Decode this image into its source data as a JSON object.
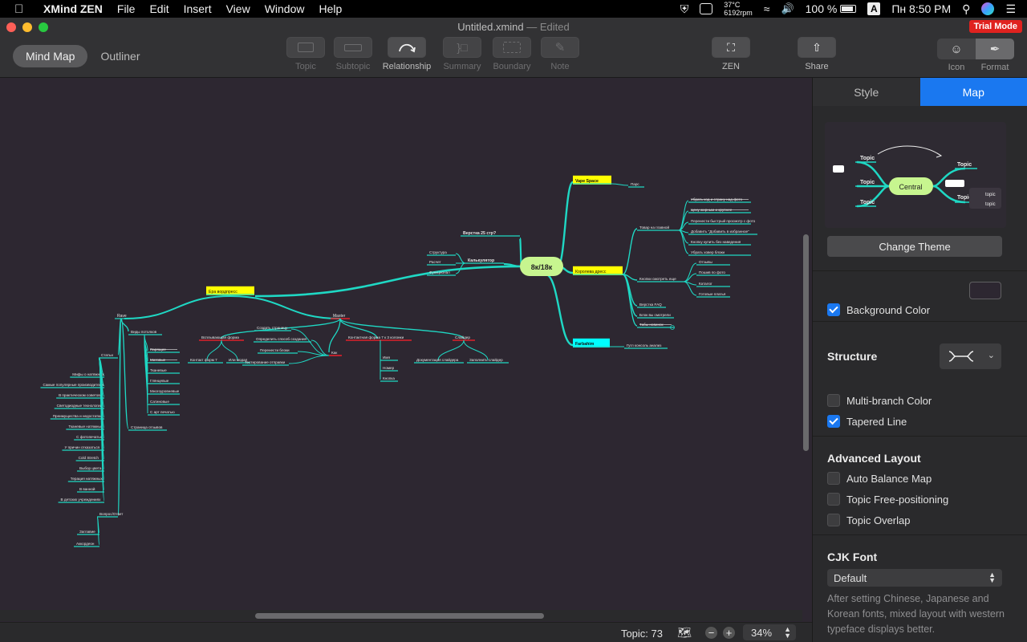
{
  "menubar": {
    "app_name": "XMind ZEN",
    "menus": [
      "File",
      "Edit",
      "Insert",
      "View",
      "Window",
      "Help"
    ],
    "temperature": "37°C",
    "fan": "6192rpm",
    "battery": "100 %",
    "input_source": "A",
    "clock": "Пн 8:50 PM"
  },
  "window": {
    "title": "Untitled.xmind",
    "edited": "— Edited",
    "trial": "Trial Mode",
    "view_tabs": [
      {
        "label": "Mind Map",
        "active": true
      },
      {
        "label": "Outliner",
        "active": false
      }
    ],
    "toolbar": [
      {
        "label": "Topic",
        "enabled": false
      },
      {
        "label": "Subtopic",
        "enabled": false
      },
      {
        "label": "Relationship",
        "enabled": true
      },
      {
        "label": "Summary",
        "enabled": false
      },
      {
        "label": "Boundary",
        "enabled": false
      },
      {
        "label": "Note",
        "enabled": false
      }
    ],
    "zen_label": "ZEN",
    "share_label": "Share",
    "icon_label": "Icon",
    "format_label": "Format"
  },
  "status": {
    "topic_count": "Topic: 73",
    "zoom": "34%"
  },
  "panel": {
    "tabs": [
      {
        "label": "Style",
        "active": false
      },
      {
        "label": "Map",
        "active": true
      }
    ],
    "preview": {
      "central": "Central",
      "topic": "Topic",
      "small_topic": "topic"
    },
    "change_theme": "Change Theme",
    "background_color": {
      "label": "Background Color",
      "checked": true,
      "color": "#2d2731"
    },
    "structure_label": "Structure",
    "multi_branch": {
      "label": "Multi-branch Color",
      "checked": false
    },
    "tapered_line": {
      "label": "Tapered Line",
      "checked": true
    },
    "advanced_layout": "Advanced Layout",
    "auto_balance": {
      "label": "Auto Balance Map",
      "checked": false
    },
    "free_position": {
      "label": "Topic Free-positioning",
      "checked": false
    },
    "overlap": {
      "label": "Topic Overlap",
      "checked": false
    },
    "cjk_font": "CJK Font",
    "font_value": "Default",
    "cjk_note": "After setting Chinese, Japanese and Korean fonts, mixed layout with western typeface displays better."
  },
  "colors": {
    "branch": "#1fd8c4",
    "central": "#c7f58f",
    "highlight_yellow": "#ffff00",
    "highlight_cyan": "#00ffff",
    "underline_red": "#e0202b",
    "accent": "#1a78f0"
  },
  "mindmap": {
    "central": "8к/18к",
    "right": {
      "vape": {
        "label": "Vape Space",
        "children": [
          "Парс"
        ]
      },
      "koroleva": {
        "label": "Королева дресс",
        "tovar": {
          "label": "Товар на главной",
          "children": [
            "Убрать код и страну над фото",
            "Цену жирным и крупнее",
            "Перенести быстрый просмотр с фото",
            "Добавить \"Добавить в избранное\"",
            "Кнопку купить без наведения",
            "Убрать ховер блоки"
          ]
        },
        "knopki": {
          "label": "Кнопки смотреть еще",
          "children": [
            "Отзывы",
            "Пошив по фото",
            "Каталог",
            "Готовые платья"
          ]
        },
        "others": [
          "Верстка FAQ",
          "Блок вы смотрели",
          "Табы новинок"
        ]
      },
      "farbahim": {
        "label": "Farbahim",
        "children": [
          "Гугл консоль анализ"
        ]
      }
    },
    "left": {
      "verstka": "Верстка 25 стр?",
      "calc": {
        "label": "Калькулятор",
        "children": [
          "Структура",
          "Расчет",
          "Функционал"
        ]
      },
      "wp": {
        "label": "Ера вордпресс",
        "rave": {
          "label": "Rave",
          "vidy": {
            "label": "Виды потолков",
            "children": [
              "Парящие",
              "Матовые",
              "Тканевые",
              "Глянцевые",
              "Многоуровневые",
              "Сатиновые",
              "С арт печатью"
            ]
          },
          "stati": {
            "label": "Статьи",
            "children": [
              "Мифы о натяжных",
              "Самые популярные производители",
              "В практическом советов",
              "Светодиодные технологии",
              "Преимущества и недостатки",
              "Тканевые натяжные",
              "С фотопечатью",
              "У причин отказаться",
              "Cold Stretch",
              "Выбор цвета",
              "Терация натяжных",
              "В ванной",
              "В детских учреждениях"
            ]
          },
          "otzyvy": "Страница отзывов",
          "faq": {
            "label": "Вопрос/Ответ",
            "children": [
              "Заглавие",
              "Аккордеон"
            ]
          }
        },
        "master": {
          "label": "Master",
          "vspl": {
            "label": "Всплывающая форма",
            "children": [
              "Контакт форм 7",
              "Или модал"
            ]
          },
          "kak": {
            "label": "Как",
            "children": [
              "Создать страницу",
              "Определить способ создания",
              "Перенести блоки",
              "Тестирование отправки"
            ]
          },
          "cf7": {
            "label": "Контактная форма 7 к 3 колонки",
            "children": [
              "Имя",
              "Номер",
              "Кнопка"
            ]
          },
          "slider": {
            "label": "Слайдер",
            "children": [
              "Документация слайдера",
              "Заполнить слайдер"
            ]
          }
        }
      }
    }
  }
}
